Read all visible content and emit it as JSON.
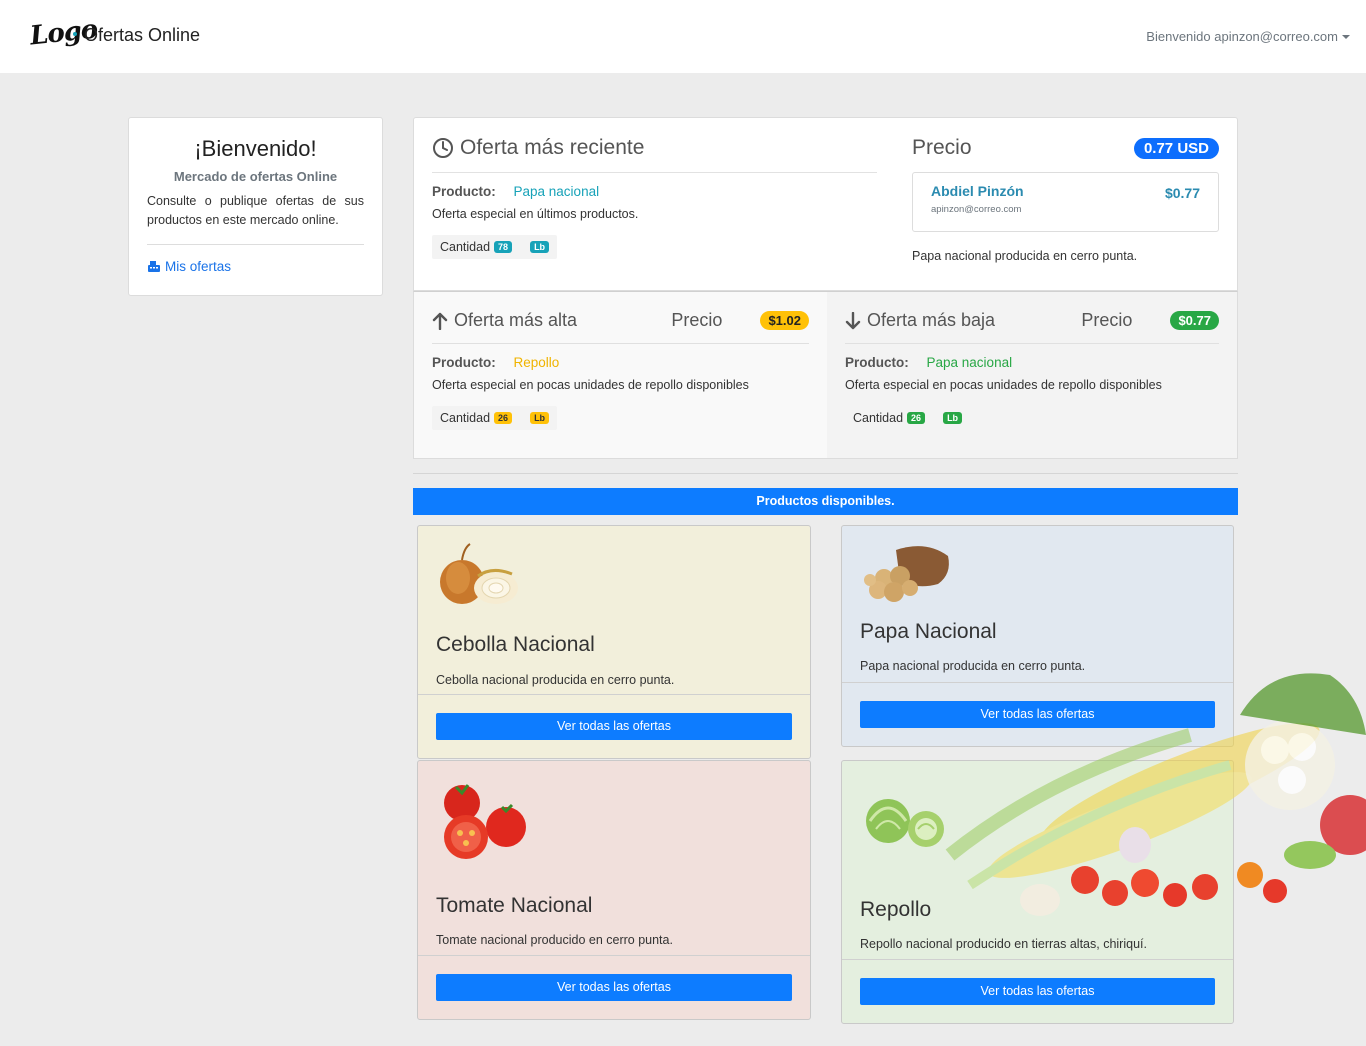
{
  "navbar": {
    "brand": "Ofertas Online",
    "logo_text": "Logo",
    "user_greeting": "Bienvenido apinzon@correo.com"
  },
  "welcome": {
    "title": "¡Bienvenido!",
    "subtitle": "Mercado de ofertas Online",
    "description": "Consulte o publique ofertas de sus productos en este mercado online.",
    "link_label": "Mis ofertas",
    "link_icon": "cash-register-icon"
  },
  "recent": {
    "title": "Oferta más reciente",
    "icon": "clock-icon",
    "product_label": "Producto:",
    "product_value": "Papa nacional",
    "description": "Oferta especial en últimos productos.",
    "quantity_label": "Cantidad",
    "quantity_value": "78",
    "unit": "Lb",
    "price_title": "Precio",
    "price_badge": "0.77 USD",
    "seller_name": "Abdiel Pinzón",
    "seller_email": "apinzon@correo.com",
    "seller_price": "$0.77",
    "note": "Papa nacional producida en cerro punta."
  },
  "highest": {
    "title": "Oferta más alta",
    "icon": "arrow-up-icon",
    "price_title": "Precio",
    "price_badge": "$1.02",
    "product_label": "Producto:",
    "product_value": "Repollo",
    "description": "Oferta especial en pocas unidades de repollo disponibles",
    "quantity_label": "Cantidad",
    "quantity_value": "26",
    "unit": "Lb"
  },
  "lowest": {
    "title": "Oferta más baja",
    "icon": "arrow-down-icon",
    "price_title": "Precio",
    "price_badge": "$0.77",
    "product_label": "Producto:",
    "product_value": "Papa nacional",
    "description": "Oferta especial en pocas unidades de repollo disponibles",
    "quantity_label": "Cantidad",
    "quantity_value": "26",
    "unit": "Lb"
  },
  "products_header": "Productos disponibles.",
  "products": [
    {
      "name": "Cebolla Nacional",
      "description": "Cebolla nacional producida en cerro punta.",
      "button": "Ver todas las ofertas",
      "image": "onion-image"
    },
    {
      "name": "Papa Nacional",
      "description": "Papa nacional producida en cerro punta.",
      "button": "Ver todas las ofertas",
      "image": "potato-image"
    },
    {
      "name": "Tomate Nacional",
      "description": "Tomate nacional producido en cerro punta.",
      "button": "Ver todas las ofertas",
      "image": "tomato-image"
    },
    {
      "name": "Repollo",
      "description": "Repollo nacional producido en tierras altas, chiriquí.",
      "button": "Ver todas las ofertas",
      "image": "cabbage-image"
    }
  ],
  "colors": {
    "primary": "#0d7cff",
    "info": "#17a2b8",
    "warning": "#ffc107",
    "success": "#28a745"
  }
}
